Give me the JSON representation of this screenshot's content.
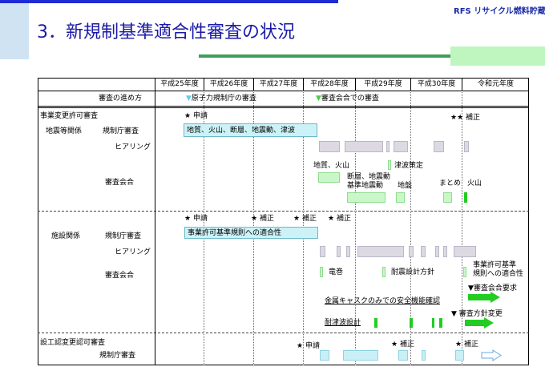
{
  "slide": {
    "title": "3．新規制基準適合性審査の状況",
    "logo": "RFS リサイクル燃料貯蔵",
    "colors": {
      "blue_bar": "#1c2bd6",
      "green_bar": "#3e9e59",
      "light_green": "#bff5bf",
      "light_blue": "#cfe3f3"
    }
  },
  "table": {
    "years": [
      "平成25年度",
      "平成26年度",
      "平成27年度",
      "平成28年度",
      "平成29年度",
      "平成30年度",
      "令和元年度"
    ],
    "progress_label": "審査の進め方",
    "progress_items": [
      "原子力規制庁の審査",
      "審査会合での審査"
    ],
    "sections": {
      "s1": {
        "title": "事業変更許可審査",
        "group": "地震等関係",
        "rows": {
          "review": "規制庁審査",
          "hearing": "ヒアリング",
          "meeting": "審査会合"
        },
        "events": [
          "申請",
          "補正"
        ],
        "box": "地質、火山、断層、地震動、津波",
        "labels": [
          "地質、火山",
          "津波策定",
          "断層、地震動",
          "基準地震動",
          "地盤",
          "まとめ",
          "火山"
        ]
      },
      "s2": {
        "group": "施設関係",
        "rows": {
          "review": "規制庁審査",
          "hearing": "ヒアリング",
          "meeting": "審査会合"
        },
        "events": [
          "申請",
          "補正",
          "補正",
          "補正"
        ],
        "box": "事業許可基準規則への適合性",
        "labels": [
          "竜巻",
          "耐震設計方針",
          "事業許可基準",
          "規則への適合性",
          "審査会合要求",
          "金属キャスクのみでの安全機能確認",
          "審査方針変更",
          "耐津波設計"
        ]
      },
      "s3": {
        "title": "設工認変更認可審査",
        "rows": {
          "review": "規制庁審査"
        },
        "events": [
          "申請",
          "補正",
          "補正"
        ]
      }
    }
  },
  "icons": {
    "star": "★",
    "tri": "▼"
  }
}
